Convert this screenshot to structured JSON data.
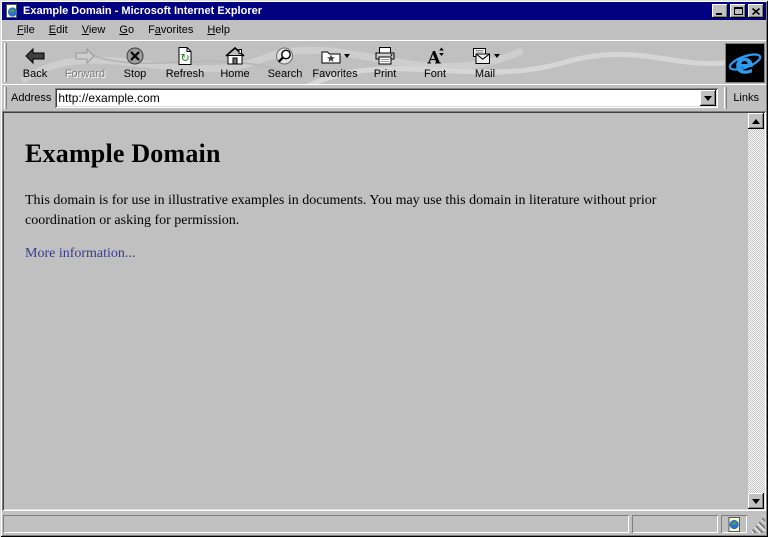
{
  "window": {
    "title": "Example Domain - Microsoft Internet Explorer"
  },
  "menu": {
    "items": [
      {
        "pre": "",
        "key": "F",
        "post": "ile"
      },
      {
        "pre": "",
        "key": "E",
        "post": "dit"
      },
      {
        "pre": "",
        "key": "V",
        "post": "iew"
      },
      {
        "pre": "",
        "key": "G",
        "post": "o"
      },
      {
        "pre": "F",
        "key": "a",
        "post": "vorites"
      },
      {
        "pre": "",
        "key": "H",
        "post": "elp"
      }
    ]
  },
  "toolbar": {
    "buttons": [
      {
        "label": "Back",
        "icon": "back-arrow-icon",
        "enabled": true,
        "dropdown": false
      },
      {
        "label": "Forward",
        "icon": "forward-arrow-icon",
        "enabled": false,
        "dropdown": false
      },
      {
        "label": "Stop",
        "icon": "stop-icon",
        "enabled": true,
        "dropdown": false
      },
      {
        "label": "Refresh",
        "icon": "refresh-icon",
        "enabled": true,
        "dropdown": false
      },
      {
        "label": "Home",
        "icon": "home-icon",
        "enabled": true,
        "dropdown": false
      },
      {
        "label": "Search",
        "icon": "search-icon",
        "enabled": true,
        "dropdown": false
      },
      {
        "label": "Favorites",
        "icon": "favorites-folder-icon",
        "enabled": true,
        "dropdown": true
      },
      {
        "label": "Print",
        "icon": "printer-icon",
        "enabled": true,
        "dropdown": false
      },
      {
        "label": "Font",
        "icon": "font-icon",
        "enabled": true,
        "dropdown": false
      },
      {
        "label": "Mail",
        "icon": "mail-icon",
        "enabled": true,
        "dropdown": true
      }
    ],
    "logo_icon": "internet-explorer-logo"
  },
  "addressbar": {
    "label": "Address",
    "value": "http://example.com",
    "links_label": "Links"
  },
  "content": {
    "heading": "Example Domain",
    "paragraph": "This domain is for use in illustrative examples in documents. You may use this domain in literature without prior coordination or asking for permission.",
    "link": "More information..."
  },
  "icons": {
    "titlebar": "ie-page-globe-icon",
    "minimize": "minimize-icon",
    "maximize": "maximize-icon",
    "close": "close-icon",
    "scroll_up": "scroll-up-arrow-icon",
    "scroll_down": "scroll-down-arrow-icon",
    "status_zone": "internet-zone-globe-icon"
  },
  "colors": {
    "titlebar": "#000080",
    "chrome": "#c0c0c0",
    "link": "#39398e",
    "ie_blue": "#2f9bf0"
  }
}
